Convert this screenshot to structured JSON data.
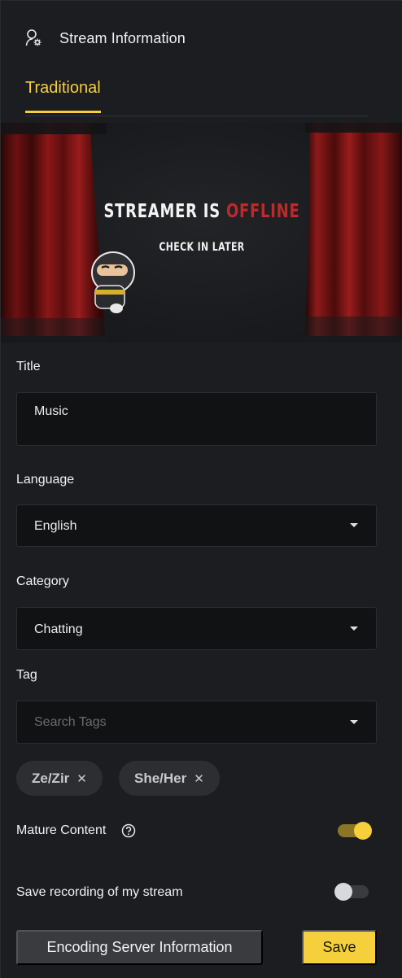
{
  "header": {
    "icon": "user-settings-icon",
    "title": "Stream Information"
  },
  "tabs": [
    {
      "label": "Traditional",
      "active": true
    }
  ],
  "preview": {
    "headline_prefix": "STREAMER IS",
    "headline_highlight": "OFFLINE",
    "subtitle": "CHECK IN LATER",
    "accent_color": "#c0282a"
  },
  "form": {
    "title": {
      "label": "Title",
      "value": "Music"
    },
    "language": {
      "label": "Language",
      "value": "English"
    },
    "category": {
      "label": "Category",
      "value": "Chatting"
    },
    "tag": {
      "label": "Tag",
      "placeholder": "Search Tags",
      "chips": [
        "Ze/Zir",
        "She/Her"
      ]
    },
    "mature_content": {
      "label": "Mature Content",
      "enabled": true
    },
    "save_recording": {
      "label": "Save recording of my stream",
      "enabled": false
    }
  },
  "buttons": {
    "encoding": "Encoding Server Information",
    "save": "Save"
  },
  "colors": {
    "accent": "#f5cf3c",
    "background": "#1c1d20",
    "field": "#111214"
  }
}
